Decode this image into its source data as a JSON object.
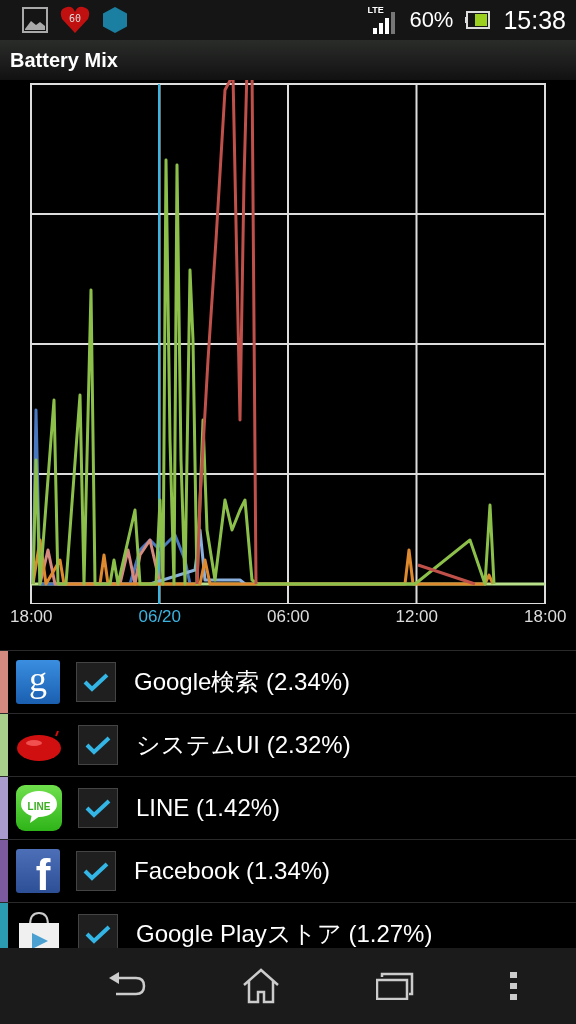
{
  "status_bar": {
    "heart_badge": "60",
    "network": "LTE",
    "battery": "60%",
    "time": "15:38"
  },
  "title": "Battery Mix",
  "chart": {
    "x_labels": [
      {
        "label": "18:00",
        "kind": "time"
      },
      {
        "label": "06/20",
        "kind": "date"
      },
      {
        "label": "06:00",
        "kind": "time"
      },
      {
        "label": "12:00",
        "kind": "time"
      },
      {
        "label": "18:00",
        "kind": "time"
      }
    ]
  },
  "apps": [
    {
      "kind": "google",
      "icon_text": "g",
      "label": "Google検索 (2.34%)",
      "checked": true,
      "color": "#d58a80"
    },
    {
      "kind": "jellybean",
      "label": "システムUI (2.32%)",
      "checked": true,
      "color": "#a8cf8c"
    },
    {
      "kind": "line",
      "icon_text": "LINE",
      "label": "LINE (1.42%)",
      "checked": true,
      "color": "#a99ccc"
    },
    {
      "kind": "facebook",
      "icon_text": "f",
      "label": "Facebook (1.34%)",
      "checked": true,
      "color": "#7b5aa0"
    },
    {
      "kind": "store",
      "label": "Google Playストア (1.27%)",
      "checked": true,
      "color": "#2a9bb0"
    }
  ]
}
